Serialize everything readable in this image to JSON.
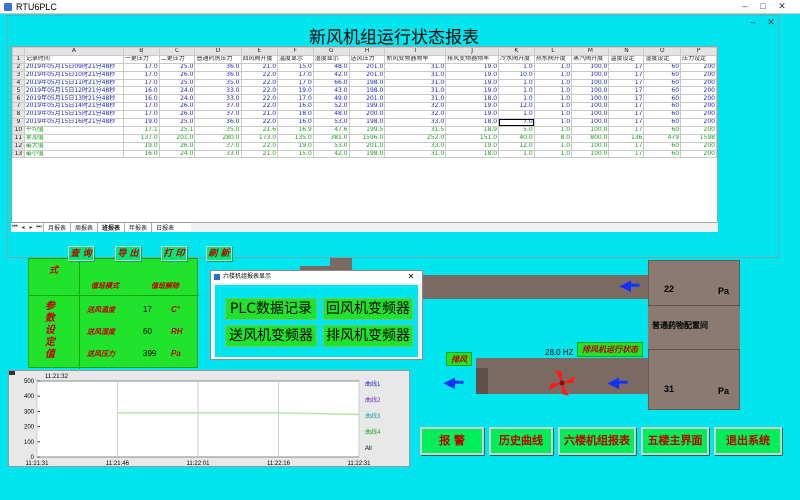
{
  "app": {
    "title": "RTU6PLC"
  },
  "report": {
    "title": "新风机组运行状态报表",
    "columns": [
      "",
      "A",
      "B",
      "C",
      "D",
      "E",
      "F",
      "G",
      "H",
      "I",
      "J",
      "K",
      "L",
      "M",
      "N",
      "O",
      "P"
    ],
    "header": [
      "记录时间",
      "一更压力",
      "二更压力",
      "普通药房压力",
      "回风阀开度",
      "温度显示",
      "湿度显示",
      "送风压力",
      "新风变频器频率",
      "排风变频器频率",
      "冷水阀开度",
      "热水阀开度",
      "蒸汽阀开度",
      "温度设定",
      "湿度设定",
      "压力设定"
    ],
    "rows": [
      [
        "2019年05月15日09时21分48秒",
        "17.0",
        "25.0",
        "36.0",
        "21.0",
        "15.0",
        "48.0",
        "201.0",
        "31.0",
        "19.0",
        "1.0",
        "1.0",
        "100.0",
        "17",
        "60",
        "200"
      ],
      [
        "2019年05月15日10时21分48秒",
        "17.0",
        "26.0",
        "36.0",
        "22.0",
        "17.0",
        "42.0",
        "201.0",
        "31.0",
        "19.0",
        "10.0",
        "1.0",
        "100.0",
        "17",
        "60",
        "200"
      ],
      [
        "2019年05月15日11时21分48秒",
        "17.0",
        "25.0",
        "35.0",
        "22.0",
        "17.0",
        "66.0",
        "198.0",
        "31.0",
        "19.0",
        "1.0",
        "1.0",
        "100.0",
        "17",
        "60",
        "200"
      ],
      [
        "2019年05月15日12时21分48秒",
        "16.0",
        "24.0",
        "33.0",
        "22.0",
        "19.0",
        "43.0",
        "198.0",
        "31.0",
        "19.0",
        "1.0",
        "1.0",
        "100.0",
        "17",
        "60",
        "200"
      ],
      [
        "2019年05月15日13时21分48秒",
        "16.0",
        "24.0",
        "33.0",
        "22.0",
        "17.0",
        "49.0",
        "201.0",
        "31.0",
        "18.0",
        "1.0",
        "1.0",
        "100.0",
        "17",
        "60",
        "200"
      ],
      [
        "2019年05月15日14时21分48秒",
        "17.0",
        "26.0",
        "37.0",
        "22.0",
        "16.0",
        "52.0",
        "199.0",
        "32.0",
        "19.0",
        "12.0",
        "1.0",
        "100.0",
        "17",
        "60",
        "200"
      ],
      [
        "2019年05月15日15时21分48秒",
        "17.0",
        "26.0",
        "37.0",
        "21.0",
        "18.0",
        "48.0",
        "200.0",
        "32.0",
        "19.0",
        "1.0",
        "1.0",
        "100.0",
        "17",
        "60",
        "200"
      ],
      [
        "2019年05月15日16时21分48秒",
        "19.0",
        "25.0",
        "36.0",
        "22.0",
        "16.0",
        "53.0",
        "198.0",
        "33.0",
        "18.0",
        "7.0",
        "1.0",
        "100.0",
        "17",
        "60",
        "200"
      ]
    ],
    "summary": [
      [
        "平均值",
        "17.1",
        "25.1",
        "35.0",
        "21.6",
        "16.9",
        "47.6",
        "199.5",
        "31.5",
        "18.9",
        "5.0",
        "1.0",
        "100.0",
        "17",
        "60",
        "200"
      ],
      [
        "累加值",
        "137.0",
        "201.0",
        "280.0",
        "173.0",
        "135.0",
        "381.0",
        "1596.0",
        "252.0",
        "151.0",
        "40.0",
        "8.0",
        "800.0",
        "136",
        "479",
        "1598"
      ],
      [
        "最大值",
        "19.0",
        "26.0",
        "37.0",
        "22.0",
        "19.0",
        "53.0",
        "201.0",
        "33.0",
        "19.0",
        "12.0",
        "1.0",
        "100.0",
        "17",
        "60",
        "200"
      ],
      [
        "最小值",
        "16.0",
        "24.0",
        "33.0",
        "21.0",
        "15.0",
        "42.0",
        "198.0",
        "31.0",
        "18.0",
        "1.0",
        "1.0",
        "100.0",
        "17",
        "60",
        "200"
      ]
    ],
    "sheet_tabs": [
      "月报表",
      "周报表",
      "班报表",
      "年报表",
      "日报表"
    ],
    "buttons": {
      "query": "查 询",
      "export": "导 出",
      "print": "打 印",
      "refresh": "刷 新"
    }
  },
  "params": {
    "side_label": "参数设定值",
    "header_mode": "值班模式",
    "header_unlock": "值班解除",
    "top_left": "式",
    "rows": [
      {
        "label": "送风温度",
        "value": "17",
        "unit": "C°"
      },
      {
        "label": "送风湿度",
        "value": "60",
        "unit": "RH"
      },
      {
        "label": "送风压力",
        "value": "399",
        "unit": "Pa"
      }
    ]
  },
  "popup": {
    "title": "六楼机组报表显示",
    "buttons": [
      "PLC数据记录",
      "回风机变频器",
      "送风机变频器",
      "排风机变频器"
    ]
  },
  "scene": {
    "pressure_top": "22",
    "pressure_bottom": "31",
    "pressure_unit": "Pa",
    "room_label": "普通药物配置间",
    "exhaust_tag": "排风",
    "fan_status": "排风机运行状态",
    "frequency": "28.0 HZ"
  },
  "trend": {
    "header_time": "11:21:32",
    "y_ticks": [
      "500",
      "400",
      "300",
      "200",
      "100",
      "0"
    ],
    "x_ticks": [
      "11:21:31",
      "11:21:46",
      "11:22:01",
      "11:22:16",
      "11:22:31"
    ],
    "legend": [
      "曲线1",
      "曲线2",
      "曲线3",
      "曲线4",
      "All"
    ]
  },
  "chart_data": {
    "type": "line",
    "x": [
      "11:21:31",
      "11:21:46",
      "11:22:01",
      "11:22:16",
      "11:22:31"
    ],
    "ylim": [
      0,
      500
    ],
    "series": [
      {
        "name": "曲线2",
        "values": [
          null,
          290,
          290,
          290,
          280
        ],
        "color": "#b7e6a0"
      }
    ]
  },
  "nav": {
    "buttons": [
      "报 警",
      "历史曲线",
      "六楼机组报表",
      "五楼主界面",
      "退出系统"
    ]
  },
  "colors": {
    "background": "#00e5ee",
    "button_green": "#00ee5a",
    "label_red": "#c00000",
    "data_blue": "#1a28b8",
    "summary_green": "#1c9c1c"
  }
}
